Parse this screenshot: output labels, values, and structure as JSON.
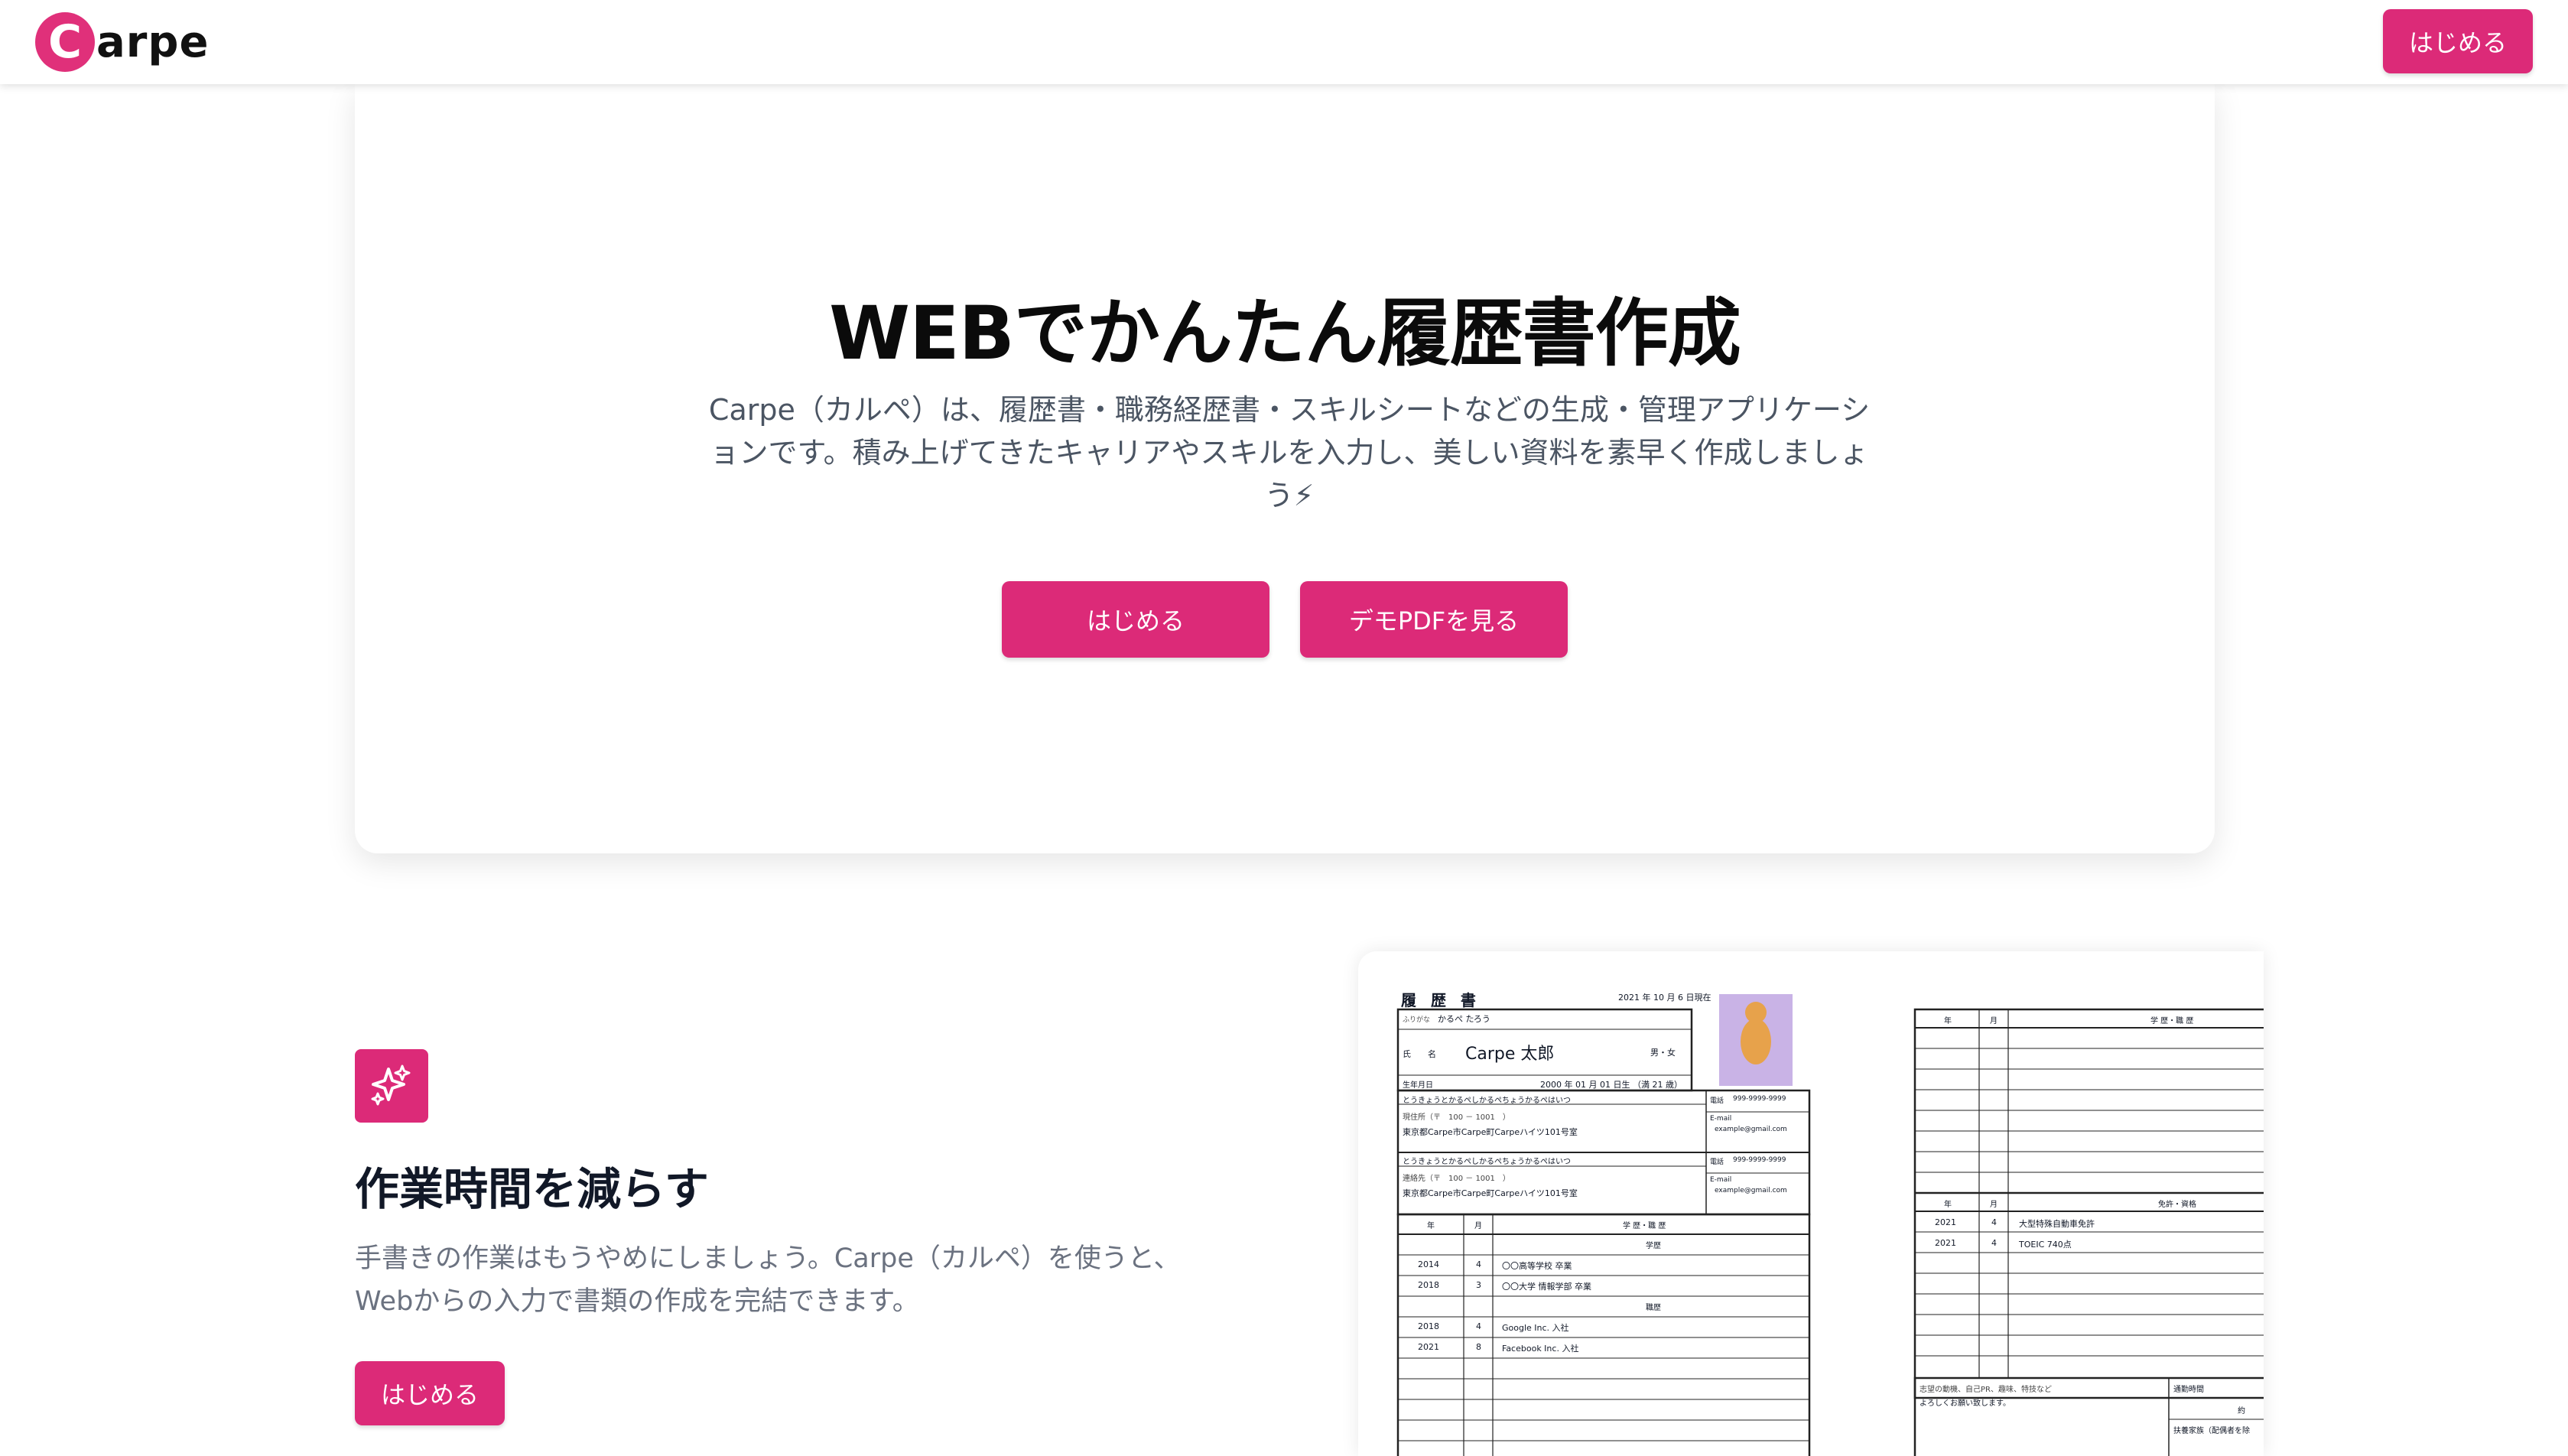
{
  "header": {
    "logo_letter": "C",
    "logo_text": "arpe",
    "cta": "はじめる"
  },
  "hero": {
    "title": "WEBでかんたん履歴書作成",
    "description": "Carpe（カルペ）は、履歴書・職務経歴書・スキルシートなどの生成・管理アプリケーションです。積み上げてきたキャリアやスキルを入力し、美しい資料を素早く作成しましょう⚡",
    "primary_button": "はじめる",
    "secondary_button": "デモPDFを見る"
  },
  "feature": {
    "icon": "sparkles-icon",
    "title": "作業時間を減らす",
    "description_line1": "手書きの作業はもうやめにしましょう。Carpe（カルペ）を使うと、",
    "description_line2": "Webからの入力で書類の作成を完結できます。",
    "button": "はじめる"
  },
  "resume_preview": {
    "heading": "履 歴 書",
    "date": "2021 年 10 月 6 日現在",
    "furigana_label": "ふりがな",
    "furigana": "かるぺ たろう",
    "name_label": "氏　　名",
    "name": "Carpe 太郎",
    "gender": "男・女",
    "birth_label": "生年月日",
    "birth": "2000 年 01 月 01 日生 （満 21 歳）",
    "address_furigana": "とうきょうとかるぺしかるぺちょうかるぺはいつ",
    "address_label": "現住所（〒　100 － 1001　）",
    "address": "東京都Carpe市Carpe町Carpeハイツ101号室",
    "tel_label": "電話",
    "tel": "999-9999-9999",
    "email_label": "E-mail",
    "email": "example@gmail.com",
    "contact_label": "連絡先（〒　100 － 1001　）",
    "col_year": "年",
    "col_month": "月",
    "col_history": "学 歴・職 歴",
    "education_header": "学歴",
    "work_header": "職歴",
    "rows": [
      {
        "year": "2014",
        "month": "4",
        "text": "〇〇高等学校 卒業"
      },
      {
        "year": "2018",
        "month": "3",
        "text": "〇〇大学 情報学部 卒業"
      },
      {
        "year": "2018",
        "month": "4",
        "text": "Google Inc. 入社"
      },
      {
        "year": "2021",
        "month": "8",
        "text": "Facebook Inc. 入社"
      }
    ],
    "license_header": "免許・資格",
    "licenses": [
      {
        "year": "2021",
        "month": "4",
        "text": "大型特殊自動車免許"
      },
      {
        "year": "2021",
        "month": "4",
        "text": "TOEIC 740点"
      }
    ],
    "motivation_label": "志望の動機、自己PR、趣味、特技など",
    "motivation": "よろしくお願い致します。",
    "commute_label": "通勤時間",
    "commute_value": "約",
    "dependents_label": "扶養家族（配偶者を除"
  }
}
